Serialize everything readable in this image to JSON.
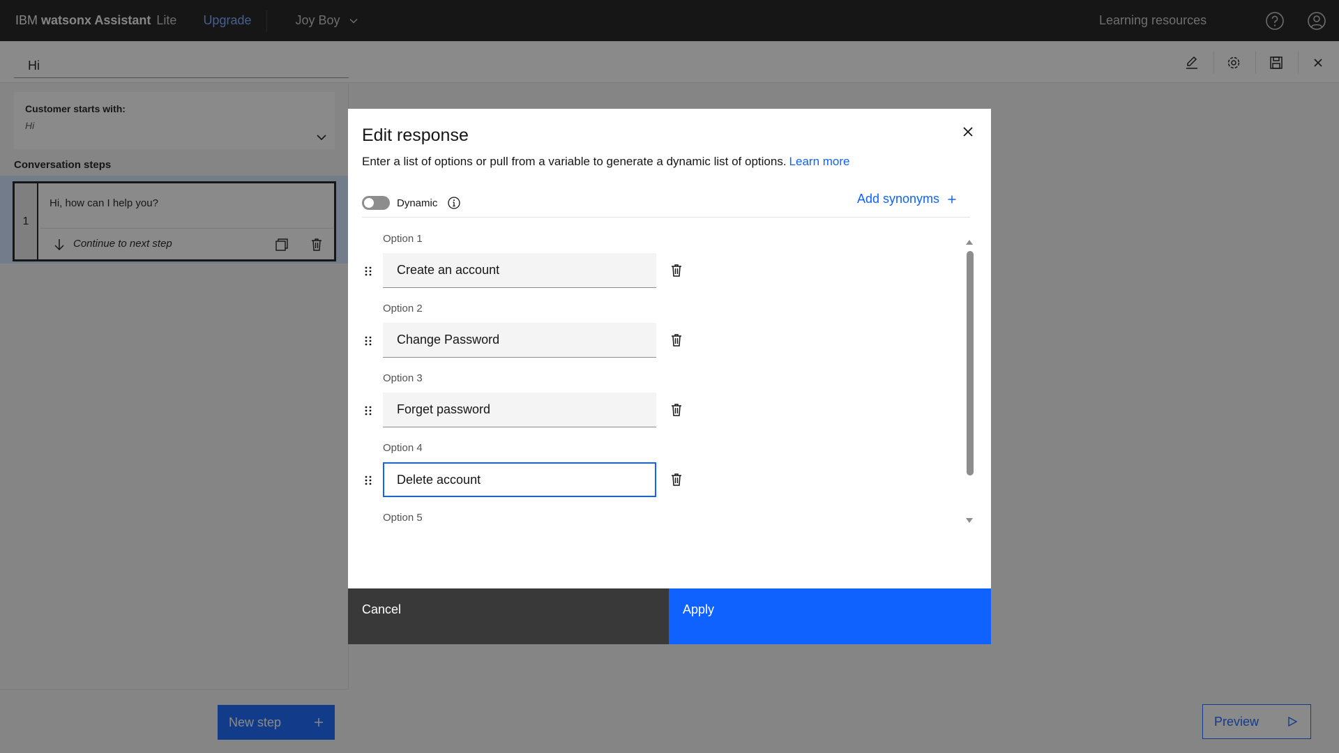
{
  "topbar": {
    "brand_prefix": "IBM ",
    "brand_name": "watsonx Assistant",
    "brand_tier": "Lite",
    "upgrade": "Upgrade",
    "account": "Joy Boy",
    "learning": "Learning resources"
  },
  "action": {
    "title": "Hi"
  },
  "left": {
    "customer_starts_label": "Customer starts with:",
    "customer_starts_value": "Hi",
    "conversation_steps_label": "Conversation steps",
    "step": {
      "number": "1",
      "text": "Hi, how can I help you?",
      "continue": "Continue to next step"
    },
    "new_step": "New step"
  },
  "preview": "Preview",
  "modal": {
    "title": "Edit response",
    "description": "Enter a list of options or pull from a variable to generate a dynamic list of options.",
    "learn_more": "Learn more",
    "dynamic_label": "Dynamic",
    "dynamic_on": false,
    "add_synonyms": "Add synonyms",
    "options": [
      {
        "label": "Option 1",
        "value": "Create an account"
      },
      {
        "label": "Option 2",
        "value": "Change Password"
      },
      {
        "label": "Option 3",
        "value": "Forget password"
      },
      {
        "label": "Option 4",
        "value": "Delete account"
      },
      {
        "label": "Option 5",
        "value": ""
      }
    ],
    "cancel": "Cancel",
    "apply": "Apply"
  },
  "colors": {
    "primary": "#0f62fe",
    "topbar": "#161616",
    "selected_step": "#d0e2ff"
  },
  "icons": [
    "help-icon",
    "user-avatar-icon",
    "edit-icon",
    "settings-icon",
    "save-icon",
    "close-icon",
    "chevron-down-icon",
    "arrow-down-icon",
    "duplicate-icon",
    "trash-icon",
    "drag-handle-icon",
    "info-icon",
    "add-icon",
    "play-icon"
  ]
}
